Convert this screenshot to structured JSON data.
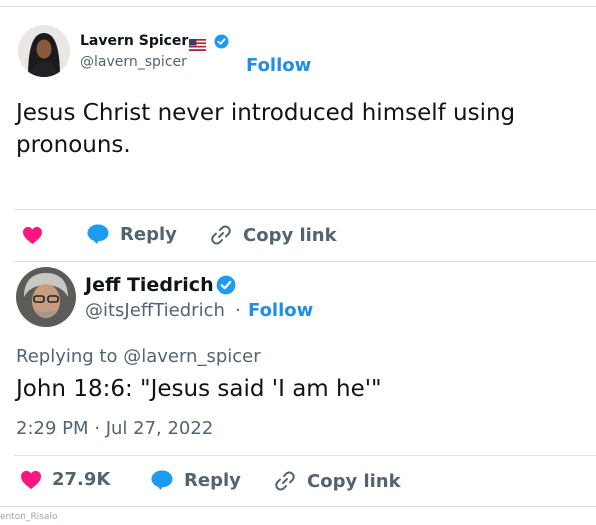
{
  "tweet1": {
    "author_name": "Lavern Spicer",
    "handle": "@lavern_spicer",
    "follow_label": "Follow",
    "text_line1": "Jesus Christ never introduced himself using",
    "text_line2": "pronouns.",
    "actions": {
      "reply_label": "Reply",
      "copy_label": "Copy link"
    }
  },
  "tweet2": {
    "author_name": "Jeff Tiedrich",
    "handle": "@itsJeffTiedrich",
    "separator": "·",
    "follow_label": "Follow",
    "replying_to": "Replying to @lavern_spicer",
    "text": "John 18:6: \"Jesus said 'I am he'\"",
    "timestamp": "2:29 PM · Jul 27, 2022",
    "actions": {
      "like_count": "27.9K",
      "reply_label": "Reply",
      "copy_label": "Copy link"
    }
  },
  "watermark": "enton_Risalo",
  "icons": [
    "us-flag-icon",
    "verified-badge-icon",
    "heart-icon",
    "reply-bubble-icon",
    "link-icon"
  ],
  "colors": {
    "accent": "#1d8fe6",
    "heart": "#f91880",
    "muted": "#536471",
    "verified": "#1d9bf0"
  }
}
